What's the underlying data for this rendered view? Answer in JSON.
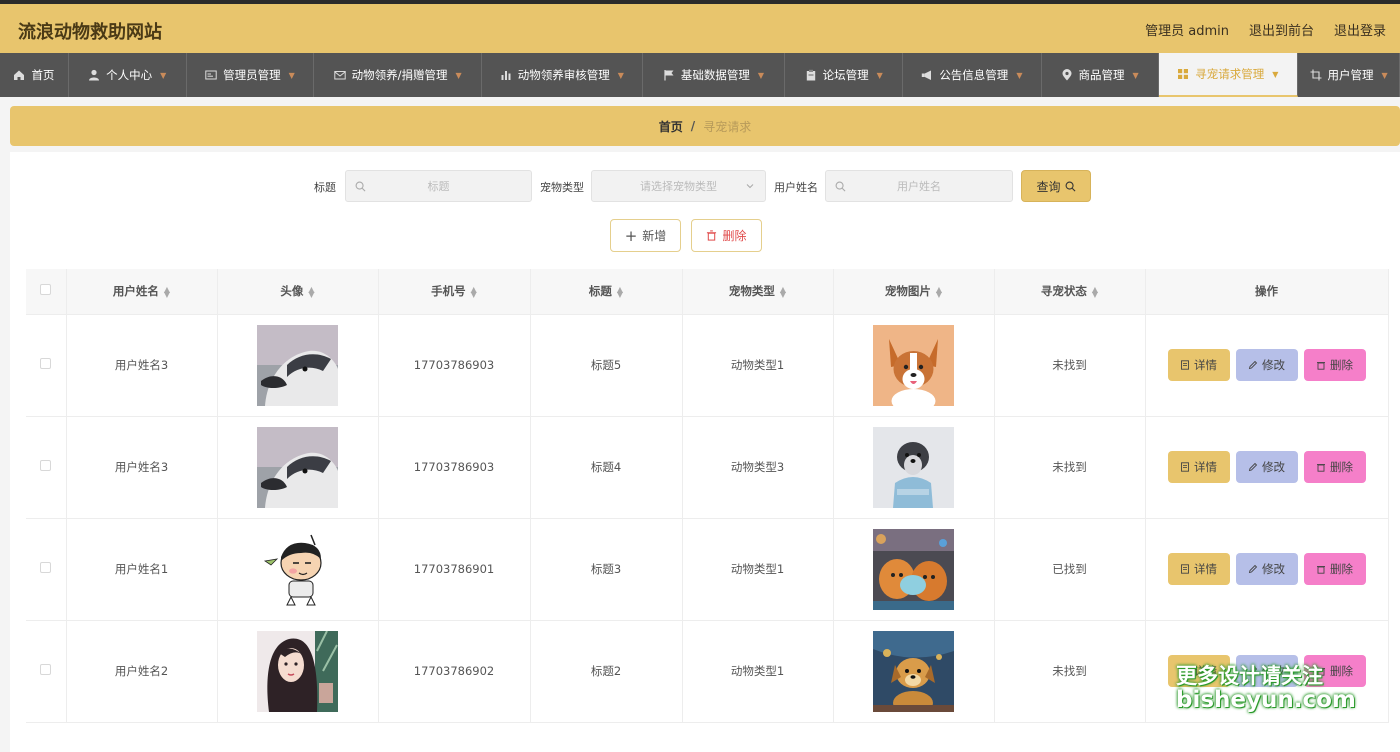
{
  "header": {
    "title": "流浪动物救助网站",
    "admin": "管理员 admin",
    "front": "退出到前台",
    "logout": "退出登录"
  },
  "nav": [
    {
      "label": "首页",
      "icon": "home-icon"
    },
    {
      "label": "个人中心",
      "icon": "user-icon"
    },
    {
      "label": "管理员管理",
      "icon": "id-card-icon"
    },
    {
      "label": "动物领养/捐赠管理",
      "icon": "mail-icon"
    },
    {
      "label": "动物领养审核管理",
      "icon": "bar-chart-icon"
    },
    {
      "label": "基础数据管理",
      "icon": "flag-icon"
    },
    {
      "label": "论坛管理",
      "icon": "clipboard-icon"
    },
    {
      "label": "公告信息管理",
      "icon": "megaphone-icon"
    },
    {
      "label": "商品管理",
      "icon": "location-pin-icon"
    },
    {
      "label": "寻宠请求管理",
      "icon": "grid-icon"
    },
    {
      "label": "用户管理",
      "icon": "crop-icon"
    }
  ],
  "breadcrumb": {
    "home": "首页",
    "sep": "/",
    "current": "寻宠请求"
  },
  "search": {
    "title_label": "标题",
    "title_placeholder": "标题",
    "type_label": "宠物类型",
    "type_placeholder": "请选择宠物类型",
    "name_label": "用户姓名",
    "name_placeholder": "用户姓名",
    "query": "查询"
  },
  "actions": {
    "add": "新增",
    "delete": "删除"
  },
  "table": {
    "headers": [
      "用户姓名",
      "头像",
      "手机号",
      "标题",
      "宠物类型",
      "宠物图片",
      "寻宠状态",
      "操作"
    ],
    "rows": [
      {
        "name": "用户姓名3",
        "avatar": "husky",
        "phone": "17703786903",
        "title": "标题5",
        "type": "动物类型1",
        "pet": "corgi",
        "status": "未找到"
      },
      {
        "name": "用户姓名3",
        "avatar": "husky",
        "phone": "17703786903",
        "title": "标题4",
        "type": "动物类型3",
        "pet": "schnauzer",
        "status": "未找到"
      },
      {
        "name": "用户姓名1",
        "avatar": "cartoon-boy",
        "phone": "17703786901",
        "title": "标题3",
        "type": "动物类型1",
        "pet": "pomeranian",
        "status": "已找到"
      },
      {
        "name": "用户姓名2",
        "avatar": "girl-illustration",
        "phone": "17703786902",
        "title": "标题2",
        "type": "动物类型1",
        "pet": "puppy-blue",
        "status": "未找到"
      }
    ],
    "ops": {
      "detail": "详情",
      "edit": "修改",
      "delete": "删除"
    }
  },
  "watermark": {
    "line1": "更多设计请关注",
    "line2": "bisheyun.com"
  }
}
